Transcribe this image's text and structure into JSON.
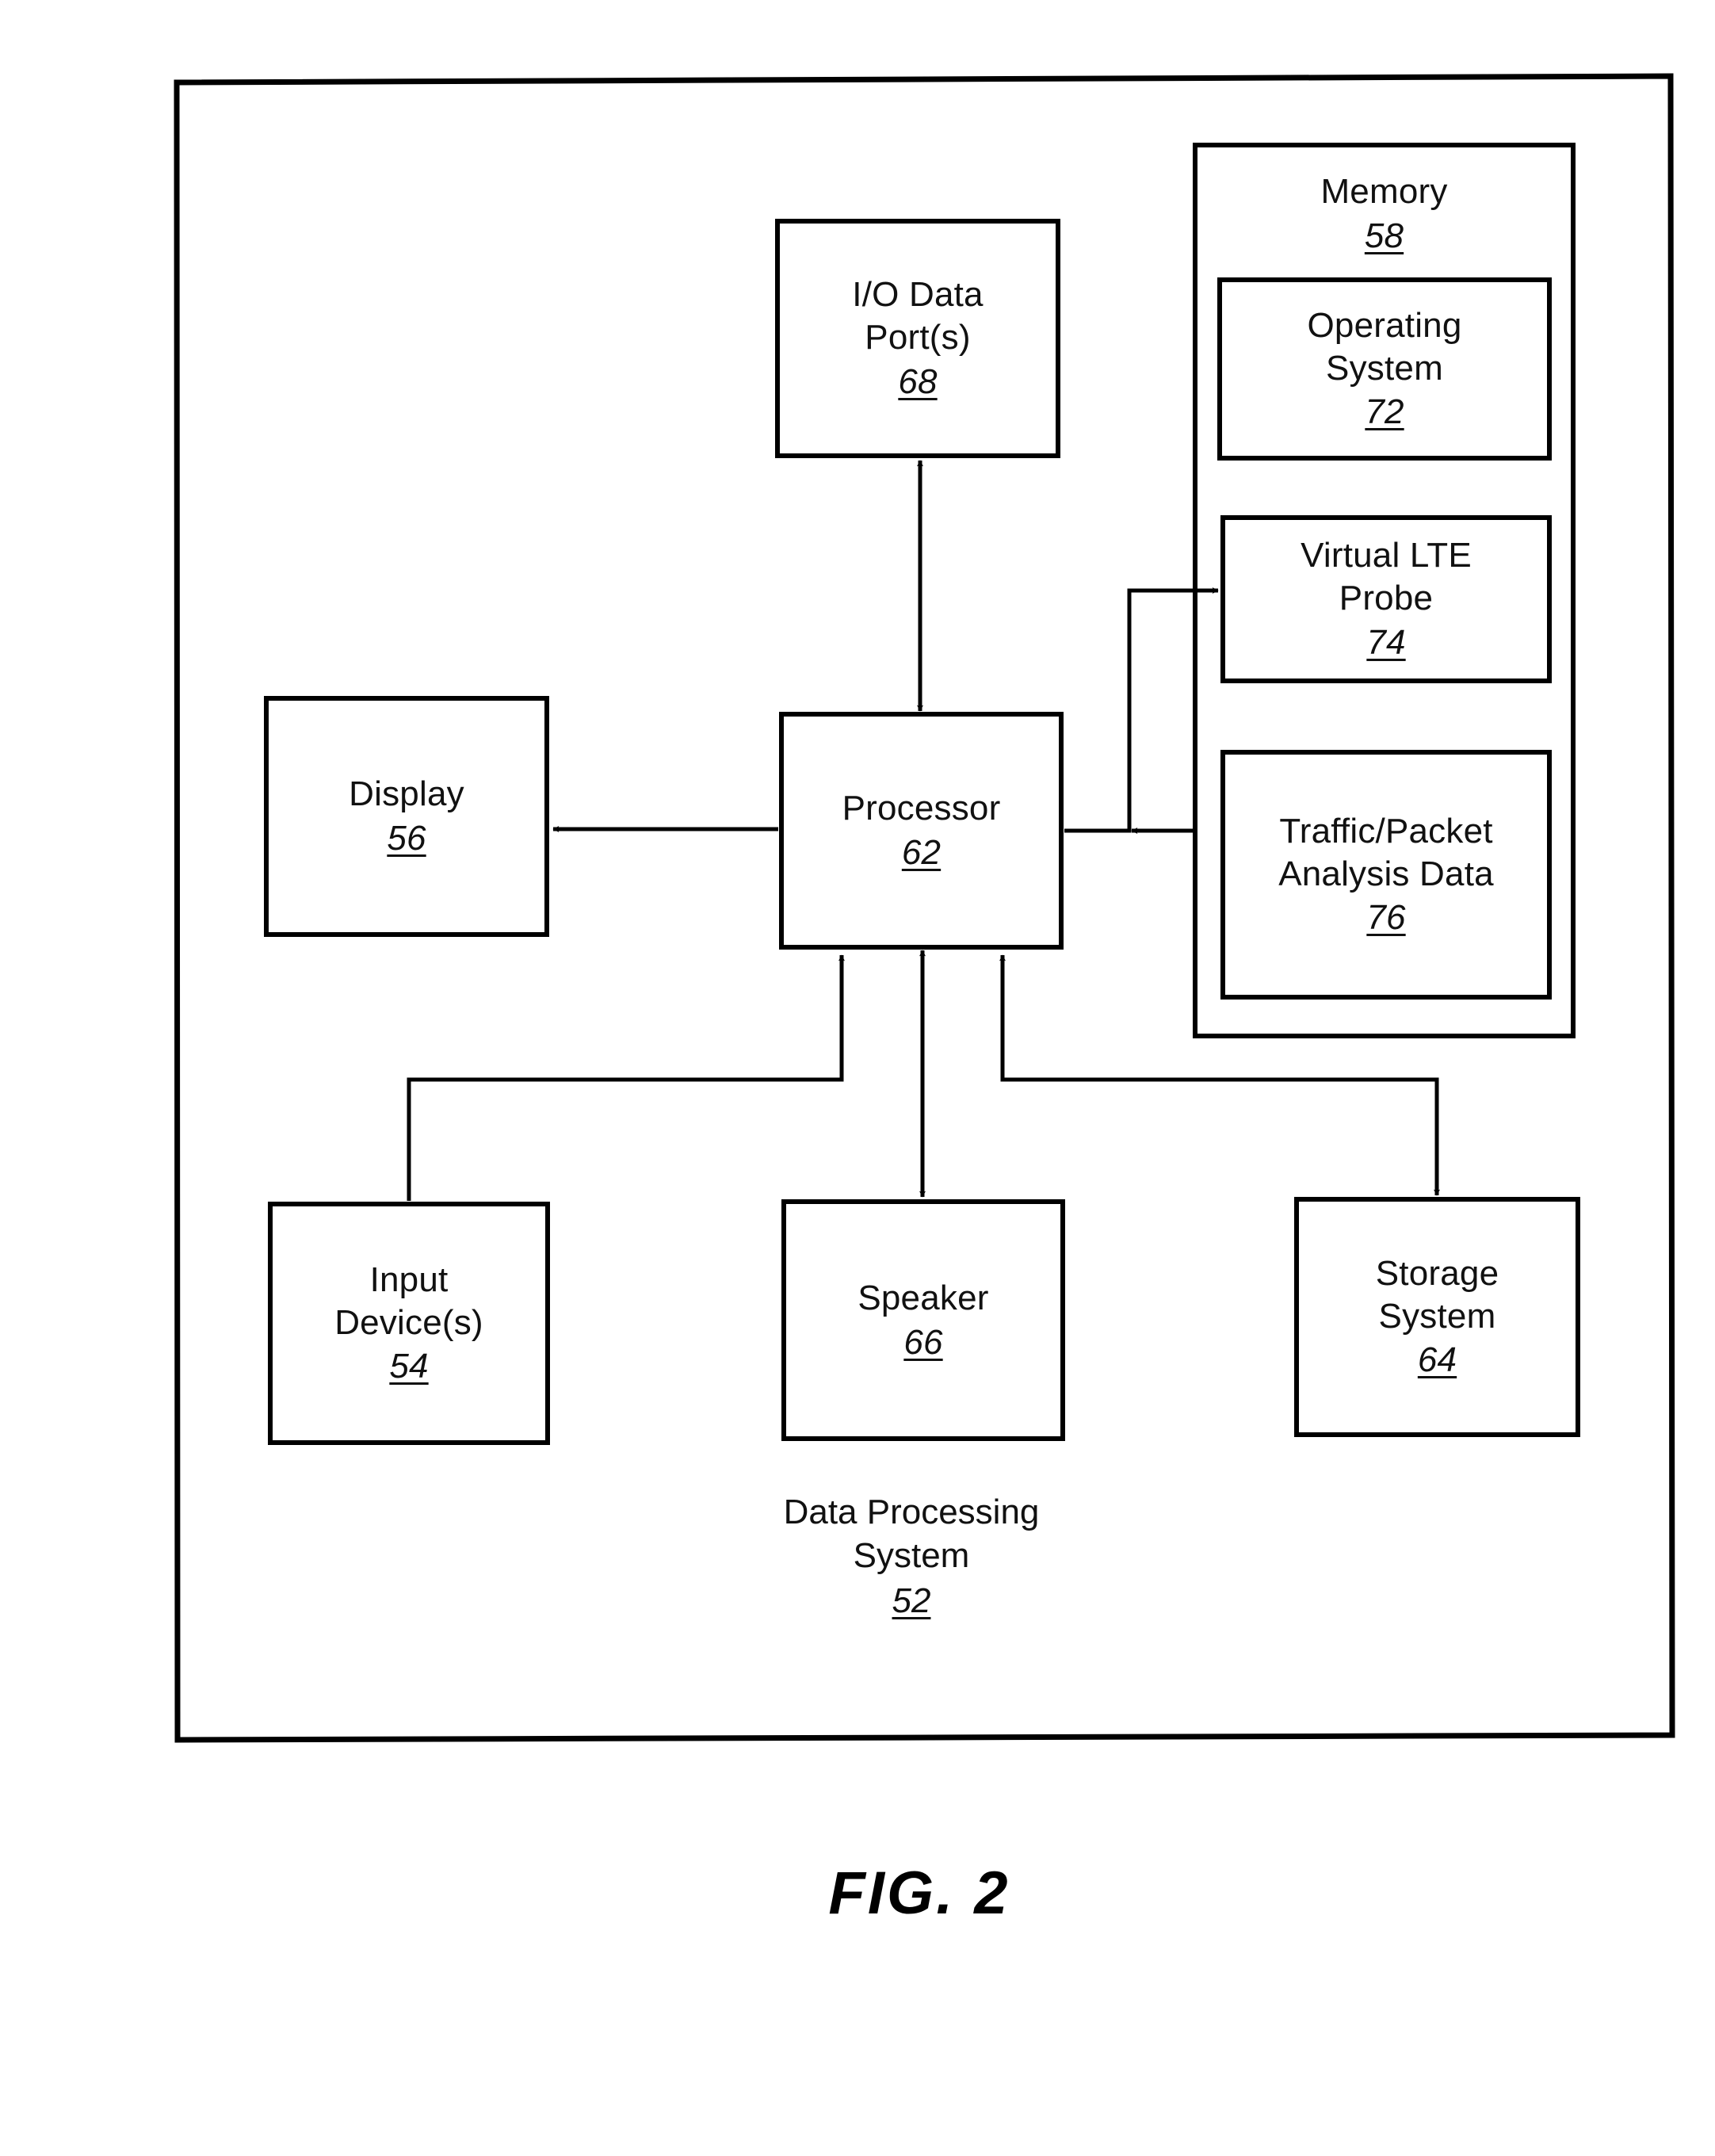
{
  "figure": {
    "caption": "FIG. 2",
    "system_label": {
      "line1": "Data Processing",
      "line2": "System",
      "ref": "52"
    }
  },
  "blocks": {
    "io_data_ports": {
      "line1": "I/O Data",
      "line2": "Port(s)",
      "ref": "68"
    },
    "memory": {
      "line1": "Memory",
      "ref": "58"
    },
    "operating_system": {
      "line1": "Operating",
      "line2": "System",
      "ref": "72"
    },
    "virtual_lte_probe": {
      "line1": "Virtual LTE",
      "line2": "Probe",
      "ref": "74"
    },
    "traffic_packet_analysis_data": {
      "line1": "Traffic/Packet",
      "line2": "Analysis Data",
      "ref": "76"
    },
    "display": {
      "line1": "Display",
      "ref": "56"
    },
    "processor": {
      "line1": "Processor",
      "ref": "62"
    },
    "input_devices": {
      "line1": "Input",
      "line2": "Device(s)",
      "ref": "54"
    },
    "speaker": {
      "line1": "Speaker",
      "ref": "66"
    },
    "storage_system": {
      "line1": "Storage",
      "line2": "System",
      "ref": "64"
    }
  },
  "connections": [
    {
      "name": "processor-to-io-data-ports",
      "from": "processor",
      "to": "io_data_ports",
      "arrow": "both"
    },
    {
      "name": "processor-to-display",
      "from": "processor",
      "to": "display",
      "arrow": "to-display"
    },
    {
      "name": "processor-to-virtual-lte-probe",
      "from": "processor",
      "to": "virtual_lte_probe",
      "arrow": "to-memory"
    },
    {
      "name": "traffic-packet-data-to-processor",
      "from": "traffic_packet_analysis_data",
      "to": "processor",
      "arrow": "to-processor"
    },
    {
      "name": "input-devices-to-processor",
      "from": "input_devices",
      "to": "processor",
      "arrow": "to-processor"
    },
    {
      "name": "processor-to-speaker",
      "from": "processor",
      "to": "speaker",
      "arrow": "both"
    },
    {
      "name": "processor-to-storage-system",
      "from": "processor",
      "to": "storage_system",
      "arrow": "to-storage"
    }
  ],
  "style": {
    "ink": "#000000",
    "paper": "#ffffff"
  }
}
